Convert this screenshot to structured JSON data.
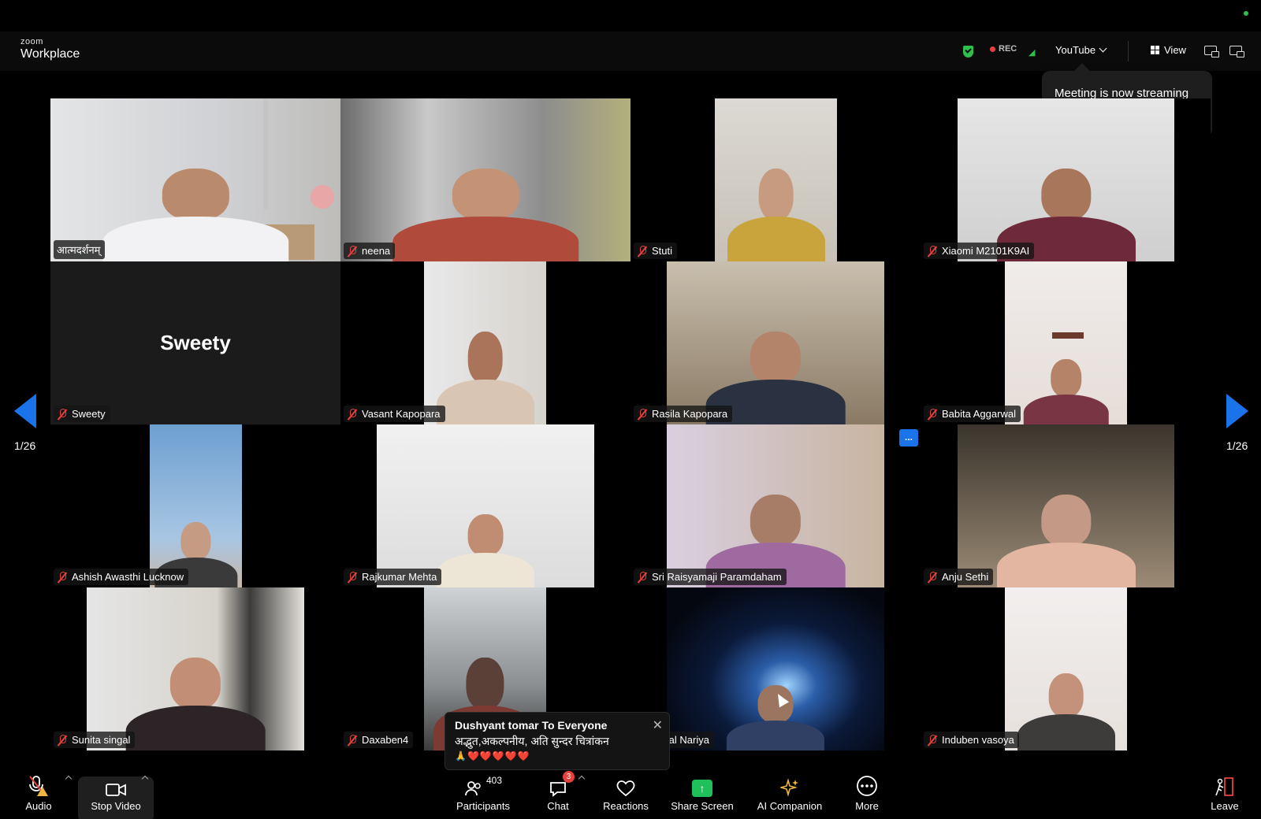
{
  "app": {
    "logo_top": "zoom",
    "logo_bottom": "Workplace"
  },
  "topbar": {
    "rec_label": "REC",
    "stream_label": "YouTube",
    "view_label": "View"
  },
  "tooltip": {
    "text": "Meeting is now streaming live on YouTube"
  },
  "tiles": [
    {
      "name": "आत्मदर्शनम्",
      "muted": false,
      "active": true
    },
    {
      "name": "neena",
      "muted": true
    },
    {
      "name": "Stuti",
      "muted": true
    },
    {
      "name": "Xiaomi M2101K9AI",
      "muted": true
    },
    {
      "name": "Sweety",
      "muted": true,
      "video_off": true,
      "big_name": "Sweety"
    },
    {
      "name": "Vasant Kapopara",
      "muted": true
    },
    {
      "name": "Rasila Kapopara",
      "muted": true
    },
    {
      "name": "Babita Aggarwal",
      "muted": true
    },
    {
      "name": "Ashish Awasthi Lucknow",
      "muted": true
    },
    {
      "name": "Rajkumar Mehta",
      "muted": true
    },
    {
      "name": "Sri Raisyamaji Paramdaham",
      "muted": true
    },
    {
      "name": "Anju Sethi",
      "muted": true
    },
    {
      "name": "Sunita singal",
      "muted": true
    },
    {
      "name": "Daxaben4",
      "muted": true
    },
    {
      "name": "Kinjal Nariya",
      "muted": true
    },
    {
      "name": "Induben vasoya",
      "muted": true
    }
  ],
  "pagination": {
    "left": "1/26",
    "right": "1/26",
    "more": "..."
  },
  "chat_popup": {
    "from": "Dushyant tomar To Everyone",
    "message": "अद्भुत,अकल्पनीय, अति सुन्दर चित्रांकन",
    "emoji": "🙏❤️❤️❤️❤️❤️"
  },
  "toolbar": {
    "audio": "Audio",
    "stop_video": "Stop Video",
    "participants": "Participants",
    "participants_count": "403",
    "chat": "Chat",
    "chat_badge": "3",
    "reactions": "Reactions",
    "share_screen": "Share Screen",
    "ai_companion": "AI Companion",
    "more": "More",
    "leave": "Leave"
  },
  "colors": {
    "accent": "#1a73e8",
    "muted_red": "#e5413d",
    "secure_green": "#2fbf4f",
    "active_border": "#d7e06a",
    "share_green": "#1fbf5a"
  }
}
